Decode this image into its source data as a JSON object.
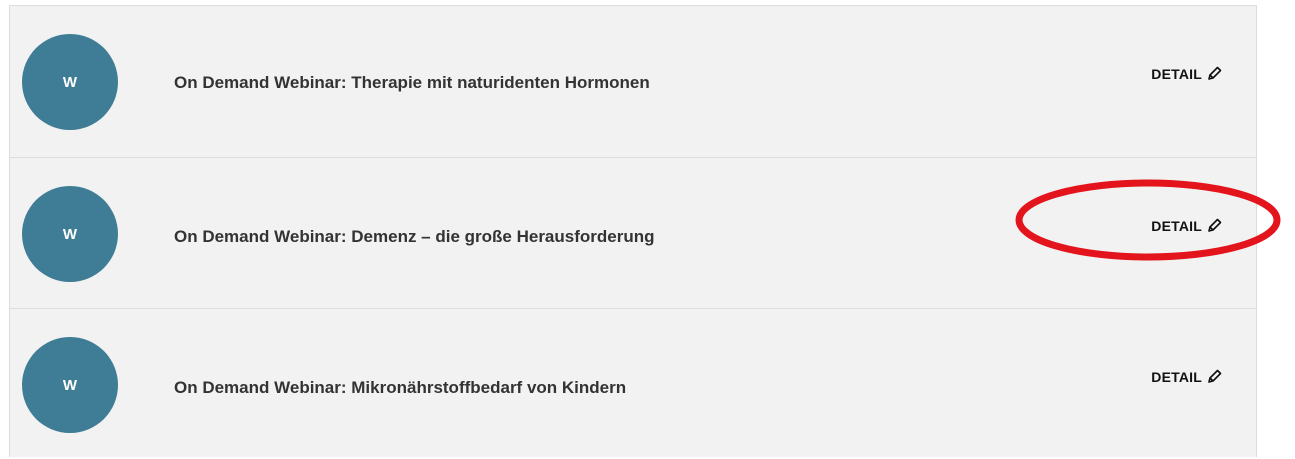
{
  "list": {
    "items": [
      {
        "avatar_letter": "W",
        "title": "On Demand Webinar: Therapie mit naturidenten Hormonen",
        "action_label": "DETAIL"
      },
      {
        "avatar_letter": "W",
        "title": "On Demand Webinar: Demenz – die große Herausforderung",
        "action_label": "DETAIL"
      },
      {
        "avatar_letter": "W",
        "title": "On Demand Webinar: Mikronährstoffbedarf von Kindern",
        "action_label": "DETAIL"
      }
    ]
  },
  "icons": {
    "action_icon": "pencil-icon"
  },
  "colors": {
    "avatar": "#3f7d96",
    "panel_background": "#f2f2f2",
    "highlight": "#e3141b"
  }
}
